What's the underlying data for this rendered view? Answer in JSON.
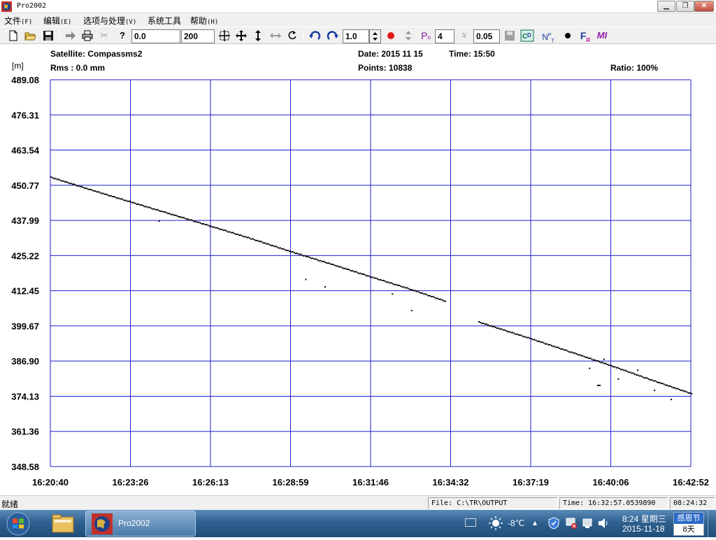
{
  "window": {
    "title": "Pro2002",
    "minimize": "▁",
    "maximize": "❐",
    "close": "✕"
  },
  "menu": [
    {
      "label": "文件",
      "acc": "(F)"
    },
    {
      "label": "编辑",
      "acc": "(E)"
    },
    {
      "label": "选项与处理",
      "acc": "(V)"
    },
    {
      "label": "系统工具",
      "acc": ""
    },
    {
      "label": "帮助",
      "acc": "(H)"
    }
  ],
  "toolbar": {
    "start_value": "0.0",
    "end_value": "200",
    "scale_value": "1.0",
    "p_value": "4",
    "x_value": "0.05",
    "p_label": "P",
    "x_label": "x"
  },
  "chart_header": {
    "satellite": "Satellite: Compassms2",
    "date": "Date: 2015 11 15",
    "time": "Time: 15:50",
    "unit": "[m]",
    "rms": "Rms :   0.0 mm",
    "points": "Points: 10838",
    "ratio": "Ratio: 100%"
  },
  "chart_data": {
    "type": "scatter",
    "ylabel": "[m]",
    "ylim": [
      348.58,
      489.08
    ],
    "yticks": [
      "489.08",
      "476.31",
      "463.54",
      "450.77",
      "437.99",
      "425.22",
      "412.45",
      "399.67",
      "386.90",
      "374.13",
      "361.36",
      "348.58"
    ],
    "xlim": [
      "16:20:40",
      "16:42:52"
    ],
    "xticks": [
      "16:20:40",
      "16:23:26",
      "16:26:13",
      "16:28:59",
      "16:31:46",
      "16:34:32",
      "16:37:19",
      "16:40:06",
      "16:42:52"
    ],
    "grid": true,
    "grid_color": "#1e1ed2",
    "point_color": "#000000",
    "series": [
      {
        "segment_1": [
          [
            "16:20:40",
            453.9
          ],
          [
            "16:22:00",
            449.5
          ],
          [
            "16:23:26",
            444.9
          ],
          [
            "16:24:50",
            440.5
          ],
          [
            "16:26:13",
            436.1
          ],
          [
            "16:27:40",
            431.4
          ],
          [
            "16:28:59",
            426.9
          ],
          [
            "16:30:20",
            422.5
          ],
          [
            "16:31:46",
            417.7
          ],
          [
            "16:33:10",
            413.1
          ],
          [
            "16:34:20",
            408.9
          ]
        ],
        "segment_2": [
          [
            "16:35:30",
            401.3
          ],
          [
            "16:36:20",
            398.5
          ],
          [
            "16:37:19",
            395.2
          ],
          [
            "16:38:40",
            390.5
          ],
          [
            "16:40:06",
            385.4
          ],
          [
            "16:41:20",
            380.8
          ],
          [
            "16:42:52",
            375.3
          ]
        ],
        "outliers": [
          [
            "16:24:25",
            438.0
          ],
          [
            "16:29:30",
            416.8
          ],
          [
            "16:30:10",
            414.1
          ],
          [
            "16:32:30",
            411.5
          ],
          [
            "16:33:10",
            405.5
          ],
          [
            "16:39:20",
            384.5
          ],
          [
            "16:39:40",
            378.3
          ],
          [
            "16:39:50",
            387.8
          ],
          [
            "16:40:20",
            380.6
          ],
          [
            "16:41:00",
            383.8
          ],
          [
            "16:41:35",
            376.5
          ],
          [
            "16:42:10",
            373.2
          ]
        ]
      }
    ]
  },
  "statusbar": {
    "status_text": "就绪",
    "file": "File: C:\\TR\\OUTPUT",
    "time": "Time: 16:32:57.0539890",
    "clock": "08:24:32"
  },
  "taskbar": {
    "app_label": "Pro2002",
    "temperature": "-8℃",
    "time": "8:24 星期三",
    "date": "2015-11-18",
    "holiday": "感恩节",
    "days": "8天"
  }
}
